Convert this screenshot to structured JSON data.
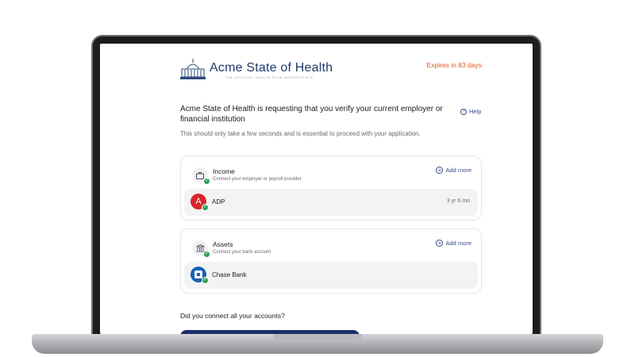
{
  "header": {
    "brand_title": "Acme State of Health",
    "brand_subtitle": "THE OFFICIAL HEALTH PLAN MARKETPLACE",
    "expires": "Expires in 83 days"
  },
  "intro": {
    "heading": "Acme State of Health is requesting that you verify your current employer or financial institution",
    "help_label": "Help",
    "subtext": "This should only take a few seconds and is essential to proceed with your application."
  },
  "income": {
    "title": "Income",
    "subtitle": "Connect your employer or payroll provider",
    "add_more": "Add more",
    "account": {
      "name": "ADP",
      "logo_letter": "A",
      "meta": "3 yr 6 mo"
    }
  },
  "assets": {
    "title": "Assets",
    "subtitle": "Connect your bank account",
    "add_more": "Add more",
    "account": {
      "name": "Chase Bank"
    }
  },
  "footer": {
    "question": "Did you connect all your accounts?"
  },
  "colors": {
    "accent": "#1d2e6b",
    "expires": "#e0571d",
    "success": "#2e9e57",
    "adp": "#d9262b",
    "chase": "#1660b6"
  },
  "icons": [
    "capitol-logo-icon",
    "help-icon",
    "briefcase-icon",
    "bank-icon",
    "plus-icon",
    "check-icon",
    "chase-logo-icon"
  ]
}
